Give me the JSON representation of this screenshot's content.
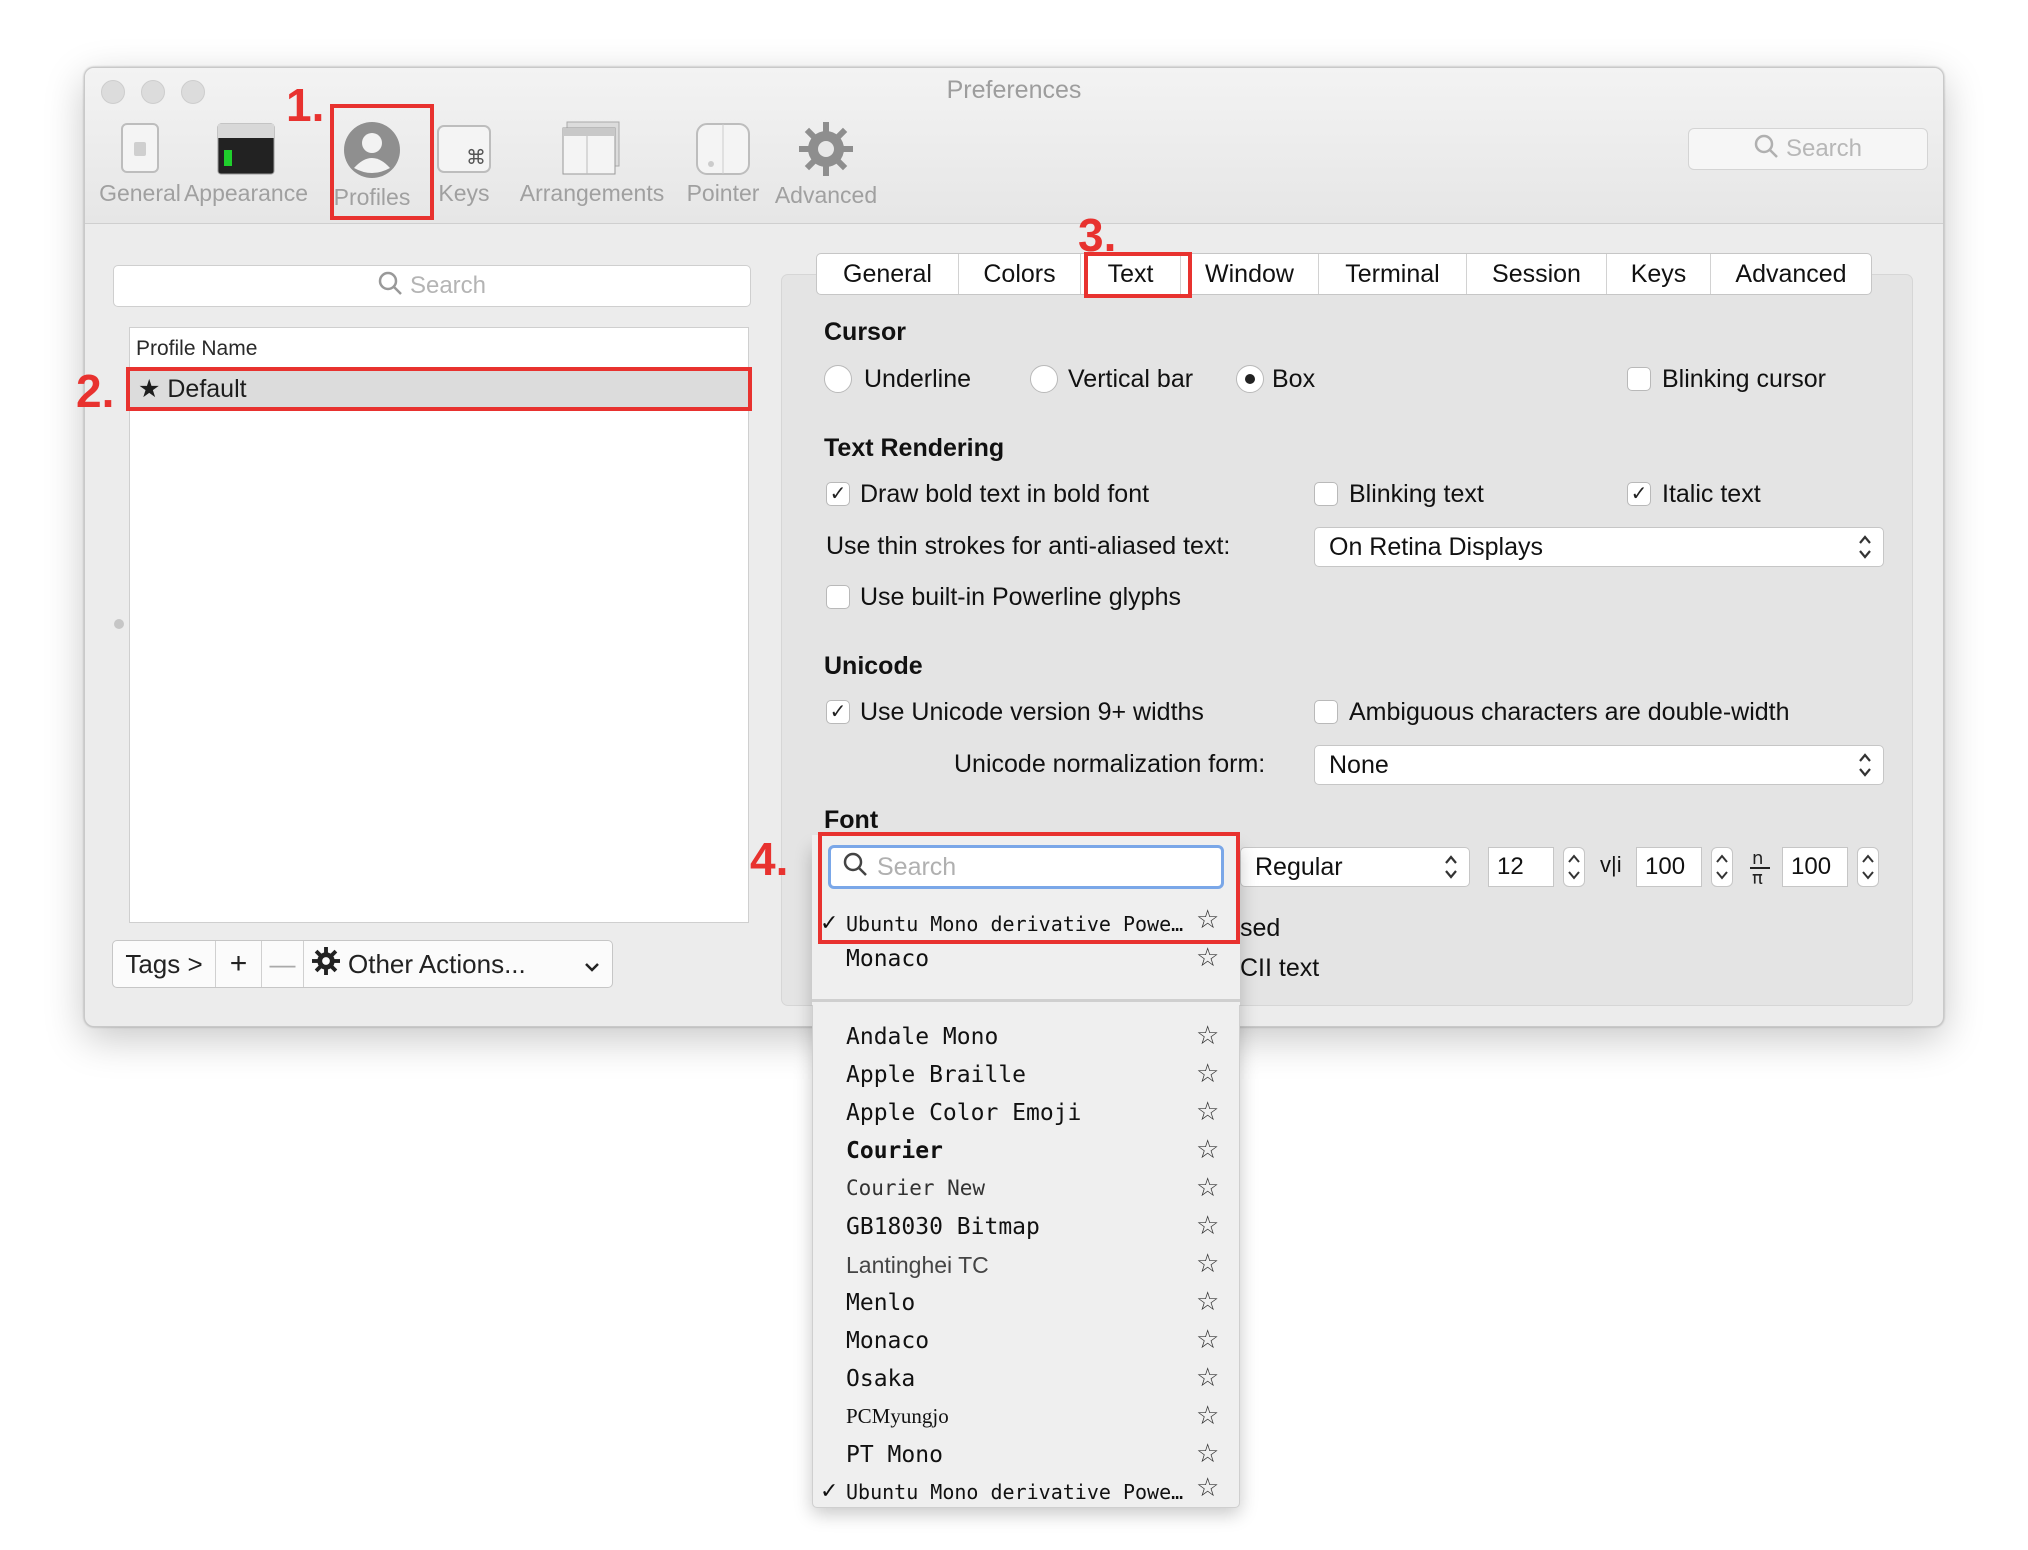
{
  "window": {
    "title": "Preferences"
  },
  "toolbar": {
    "items": [
      {
        "label": "General",
        "icon": "general-icon"
      },
      {
        "label": "Appearance",
        "icon": "appearance-icon"
      },
      {
        "label": "Profiles",
        "icon": "profiles-icon"
      },
      {
        "label": "Keys",
        "icon": "keys-icon"
      },
      {
        "label": "Arrangements",
        "icon": "arrangements-icon"
      },
      {
        "label": "Pointer",
        "icon": "pointer-icon"
      },
      {
        "label": "Advanced",
        "icon": "gear-icon"
      }
    ],
    "search_placeholder": "Search"
  },
  "profiles": {
    "search_placeholder": "Search",
    "column_header": "Profile Name",
    "rows": [
      {
        "name": "★ Default"
      }
    ],
    "bottom_bar": {
      "tags": "Tags >",
      "add": "+",
      "remove": "—",
      "other_actions": "Other Actions..."
    }
  },
  "tabs": [
    "General",
    "Colors",
    "Text",
    "Window",
    "Terminal",
    "Session",
    "Keys",
    "Advanced"
  ],
  "cursor": {
    "title": "Cursor",
    "options": [
      "Underline",
      "Vertical bar",
      "Box"
    ],
    "selected": "Box",
    "blinking_label": "Blinking cursor",
    "blinking_checked": false
  },
  "text_rendering": {
    "title": "Text Rendering",
    "bold_label": "Draw bold text in bold font",
    "bold_checked": true,
    "blinking_text_label": "Blinking text",
    "blinking_text_checked": false,
    "italic_label": "Italic text",
    "italic_checked": true,
    "thin_strokes_label": "Use thin strokes for anti-aliased text:",
    "thin_strokes_value": "On Retina Displays",
    "powerline_label": "Use built-in Powerline glyphs",
    "powerline_checked": false
  },
  "unicode": {
    "title": "Unicode",
    "v9_label": "Use Unicode version 9+ widths",
    "v9_checked": true,
    "ambiguous_label": "Ambiguous characters are double-width",
    "ambiguous_checked": false,
    "normalization_label": "Unicode normalization form:",
    "normalization_value": "None"
  },
  "font": {
    "title": "Font",
    "style_value": "Regular",
    "size_value": "12",
    "h_spacing_value": "100",
    "v_spacing_value": "100",
    "partial_line1": "sed",
    "partial_line2": "CII text",
    "menu_search_placeholder": "Search",
    "recent": [
      {
        "name": "Ubuntu Mono derivative Powe…",
        "checked": true
      },
      {
        "name": "Monaco",
        "checked": false
      }
    ],
    "all": [
      {
        "name": "Andale Mono",
        "checked": false
      },
      {
        "name": "Apple Braille",
        "checked": false
      },
      {
        "name": "Apple  Color  Emoji",
        "checked": false
      },
      {
        "name": "Courier",
        "checked": false
      },
      {
        "name": "Courier New",
        "checked": false
      },
      {
        "name": "GB18030  Bitmap",
        "checked": false
      },
      {
        "name": "Lantinghei TC",
        "checked": false
      },
      {
        "name": "Menlo",
        "checked": false
      },
      {
        "name": "Monaco",
        "checked": false
      },
      {
        "name": "Osaka",
        "checked": false
      },
      {
        "name": "PCMyungjo",
        "checked": false
      },
      {
        "name": "PT  Mono",
        "checked": false
      },
      {
        "name": "Ubuntu Mono derivative Powe…",
        "checked": true
      }
    ]
  },
  "annotations": [
    "1.",
    "2.",
    "3.",
    "4."
  ],
  "colors": {
    "annotation_red": "#e8322f",
    "focus_blue": "#7aa7e8"
  }
}
